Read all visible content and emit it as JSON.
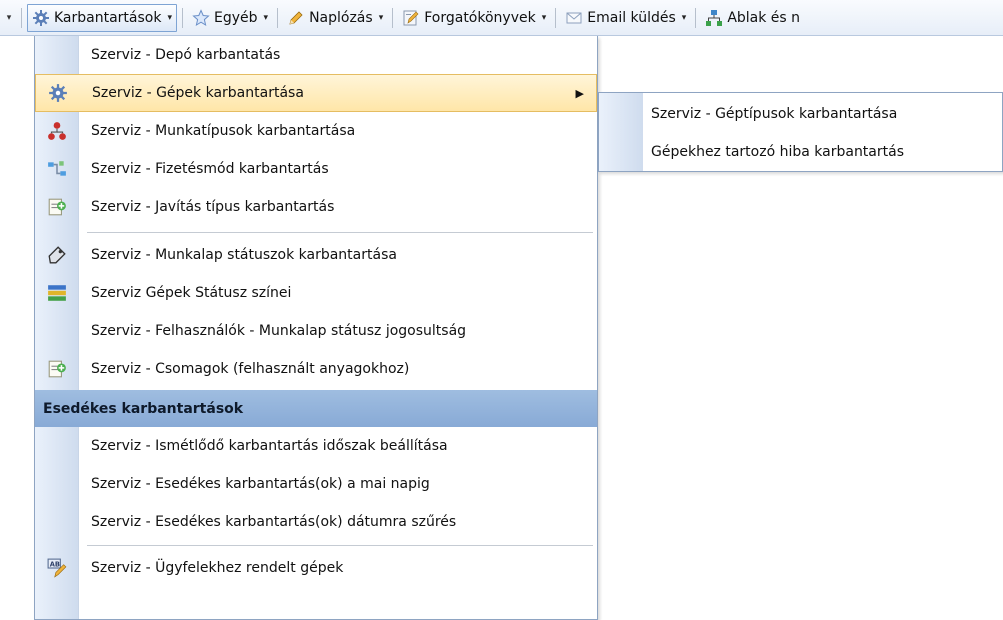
{
  "toolbar": {
    "items": [
      {
        "label": "Karbantartások",
        "icon": "gear-icon"
      },
      {
        "label": "Egyéb",
        "icon": "star-icon"
      },
      {
        "label": "Naplózás",
        "icon": "pencil-icon"
      },
      {
        "label": "Forgatókönyvek",
        "icon": "script-icon"
      },
      {
        "label": "Email küldés",
        "icon": "envelope-icon"
      },
      {
        "label": "Ablak és n",
        "icon": "network-icon"
      }
    ]
  },
  "menu": {
    "items": [
      {
        "label": "Szerviz - Depó karbantatás",
        "icon": null
      },
      {
        "label": "Szerviz - Gépek karbantartása",
        "icon": "gear-icon",
        "has_submenu": true,
        "highlighted": true
      },
      {
        "label": "Szerviz - Munkatípusok karbantartása",
        "icon": "hierarchy-icon"
      },
      {
        "label": "Szerviz - Fizetésmód karbantartás",
        "icon": "flow-icon"
      },
      {
        "label": "Szerviz - Javítás típus karbantartás",
        "icon": "document-add-icon"
      },
      {
        "label": "Szerviz - Munkalap státuszok karbantartása",
        "icon": "tag-icon"
      },
      {
        "label": "Szerviz Gépek Státusz színei",
        "icon": "color-bars-icon"
      },
      {
        "label": "Szerviz - Felhasználók - Munkalap státusz jogosultság",
        "icon": null
      },
      {
        "label": "Szerviz - Csomagok (felhasznált anyagokhoz)",
        "icon": "document-add-icon"
      }
    ],
    "section_header": "Esedékes karbantartások",
    "section_items": [
      {
        "label": "Szerviz - Ismétlődő karbantartás időszak beállítása",
        "icon": null
      },
      {
        "label": "Szerviz - Esedékes karbantartás(ok) a mai napig",
        "icon": null
      },
      {
        "label": "Szerviz - Esedékes karbantartás(ok) dátumra szűrés",
        "icon": null
      }
    ],
    "last_items": [
      {
        "label": "Szerviz - Ügyfelekhez rendelt gépek",
        "icon": "ab-pencil-icon"
      }
    ]
  },
  "submenu": {
    "items": [
      {
        "label": "Szerviz - Géptípusok karbantartása"
      },
      {
        "label": "Gépekhez tartozó hiba karbantartás"
      }
    ]
  },
  "colors": {
    "highlight": "#ffe6a8",
    "section_header": "#93b3dc",
    "gutter": "#cfdcee"
  }
}
